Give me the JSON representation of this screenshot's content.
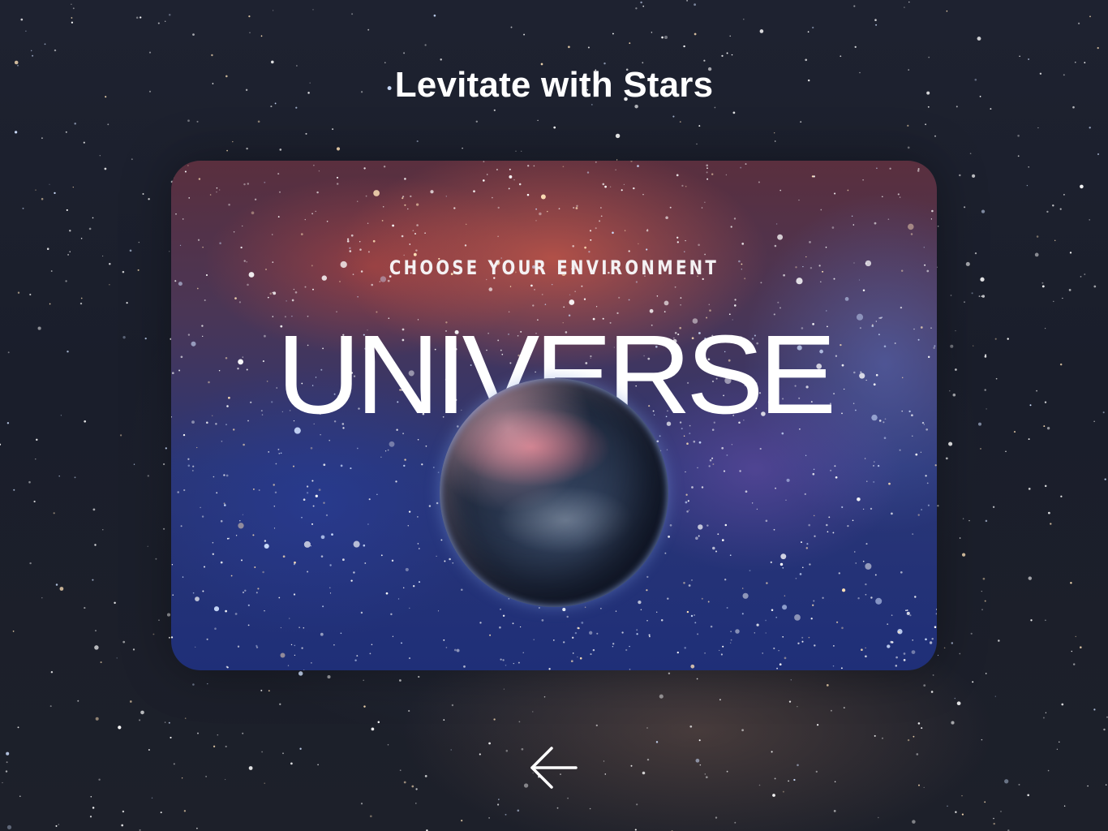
{
  "page": {
    "title": "Levitate with Stars"
  },
  "card": {
    "eyebrow": "CHOOSE YOUR ENVIRONMENT",
    "headline": "UNIVERSE",
    "image": "planet-in-galaxy"
  },
  "navigation": {
    "back_icon": "arrow-left-icon"
  },
  "colors": {
    "background": "#1b1f2b",
    "text": "#ffffff"
  }
}
